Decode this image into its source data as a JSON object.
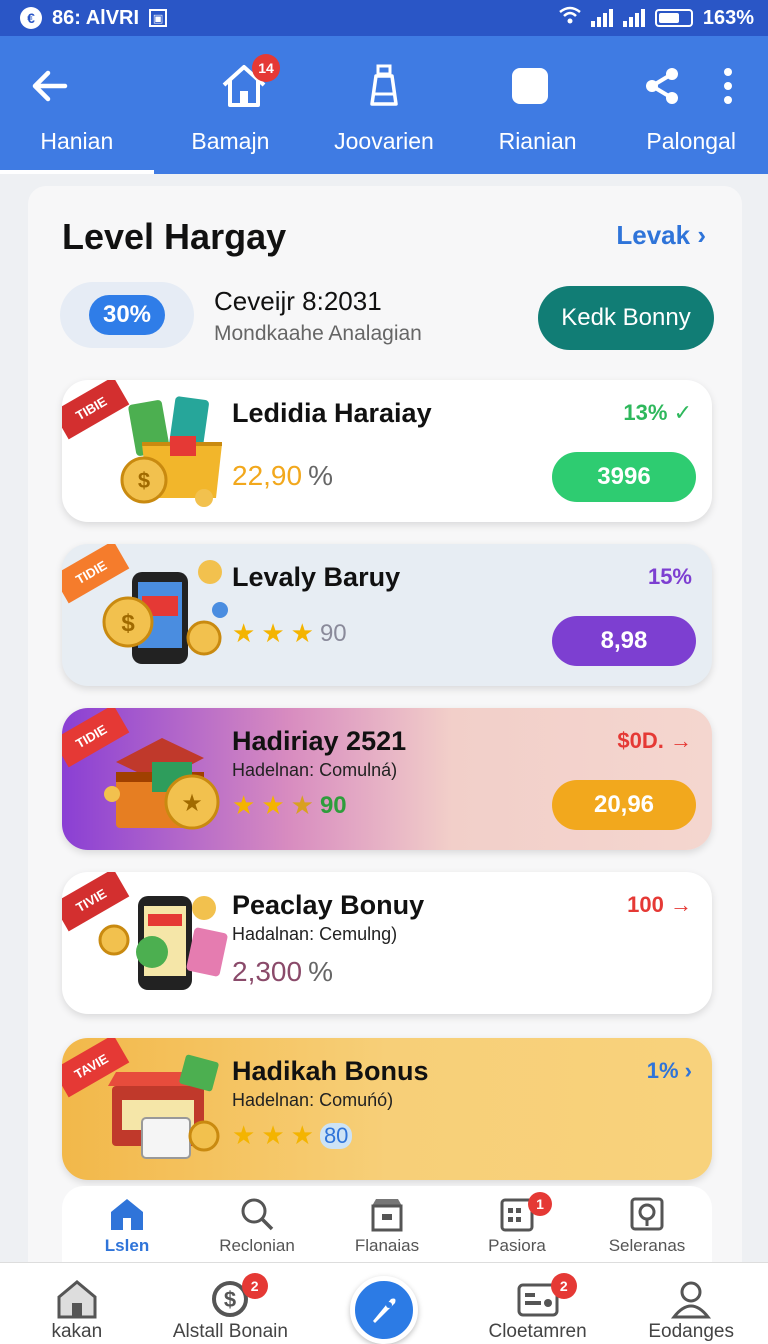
{
  "status_bar": {
    "time": "86: AlVRI",
    "battery": "163%"
  },
  "header": {
    "notification_count": "14",
    "tabs": [
      "Hanian",
      "Bamajn",
      "Joovarien",
      "Rianian",
      "Palongal"
    ]
  },
  "summary": {
    "title": "Level Hargay",
    "link": "Levak",
    "percent": "30%",
    "date_text": "Ceveijr 8:2031",
    "subtitle": "Mondkaahe Analagian",
    "button": "Kedk Bonny"
  },
  "cards": [
    {
      "ribbon": "TIBIE",
      "title": "Ledidia Haraiay",
      "value": "22,90",
      "value_unit": "%",
      "right": "13%",
      "pill": "3996"
    },
    {
      "ribbon": "TIDIE",
      "title": "Levaly Baruy",
      "stars": "90",
      "right": "15%",
      "pill": "8,98"
    },
    {
      "ribbon": "TIDIE",
      "title": "Hadiriay 2521",
      "subtitle": "Hadelnan: Comulná)",
      "stars": "90",
      "right": "$0D.",
      "pill": "20,96"
    },
    {
      "ribbon": "TIVIE",
      "title": "Peaclay Bonuy",
      "subtitle": "Hadalnan: Cemulng)",
      "value": "2,300",
      "value_unit": "%",
      "right": "100"
    },
    {
      "ribbon": "TAVIE",
      "title": "Hadikah Bonus",
      "subtitle": "Hadelnan: Comuńó)",
      "stars": "80",
      "right": "1%"
    }
  ],
  "inner_nav": [
    {
      "label": "Lslen"
    },
    {
      "label": "Reclonian"
    },
    {
      "label": "Flanaias"
    },
    {
      "label": "Pasiora",
      "badge": "1"
    },
    {
      "label": "Seleranas"
    }
  ],
  "bottom_nav": [
    {
      "label": "kakan"
    },
    {
      "label": "Alstall Bonain",
      "badge": "2"
    },
    {
      "label": ""
    },
    {
      "label": "Cloetamren",
      "badge": "2"
    },
    {
      "label": "Eodanges"
    }
  ],
  "colors": {
    "primary": "#3f7be3",
    "teal": "#117d75",
    "green": "#2ecc71",
    "purple": "#7d3fd1",
    "orange": "#f2a81d",
    "red": "#e53935"
  }
}
